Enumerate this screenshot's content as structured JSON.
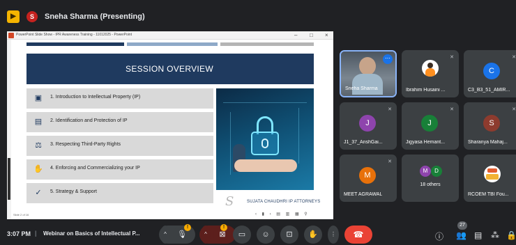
{
  "presenter_bar": {
    "app_icon": "meet-logo-icon",
    "presenter_initial": "S",
    "presenter_title": "Sneha Sharma (Presenting)"
  },
  "powerpoint": {
    "titlebar_text": "PowerPoint Slide Show - IPR Awareness Training - 11012025 - PowerPoint",
    "slide_status": "Slide 2 of 16",
    "slide": {
      "heading": "SESSION OVERVIEW",
      "items": [
        {
          "icon": "presentation-icon",
          "label": "1. Introduction to Intellectual Property (IP)"
        },
        {
          "icon": "certificate-icon",
          "label": "2. Identification and Protection of IP"
        },
        {
          "icon": "balance-icon",
          "label": "3. Respecting Third-Party Rights"
        },
        {
          "icon": "handshake-icon",
          "label": "4. Enforcing and Commercializing your IP"
        },
        {
          "icon": "checkmark-icon",
          "label": "5. Strategy & Support"
        }
      ],
      "firm_name": "SUJATA CHAUDHRI IP ATTORNEYS"
    }
  },
  "participants": [
    {
      "name": "Sneha Sharma",
      "type": "video",
      "speaking": true
    },
    {
      "name": "Ibrahim Husaini ...",
      "type": "photo",
      "muted": true
    },
    {
      "name": "C3_B3_51_AMIR...",
      "type": "initial",
      "initial": "C",
      "color": "#1a73e8",
      "muted": true
    },
    {
      "name": "J1_37_AnshGai...",
      "type": "initial",
      "initial": "J",
      "color": "#8e44ad",
      "muted": true
    },
    {
      "name": "Jigyasa Hemant...",
      "type": "initial",
      "initial": "J",
      "color": "#188038",
      "muted": true
    },
    {
      "name": "Sharanya Mahaj...",
      "type": "initial",
      "initial": "S",
      "color": "#8d3b2e",
      "muted": true
    },
    {
      "name": "MEET AGRAWAL",
      "type": "initial",
      "initial": "M",
      "color": "#e8710a",
      "muted": true
    },
    {
      "name": "18 others",
      "type": "group",
      "initials": [
        "M",
        "D"
      ]
    },
    {
      "name": "RCOEM TBI Fou...",
      "type": "logo"
    }
  ],
  "bottom_bar": {
    "time": "3:07 PM",
    "separator": "|",
    "meeting_title": "Webinar on Basics of Intellectual P...",
    "warning_badge": "!",
    "participant_count": "27",
    "controls": [
      "chevron-up-icon",
      "microphone-icon",
      "chevron-up-icon",
      "camera-off-icon",
      "captions-icon",
      "emoji-icon",
      "present-icon",
      "raise-hand-icon",
      "more-options-icon",
      "hangup-icon",
      "info-icon",
      "people-icon",
      "chat-icon",
      "activities-icon",
      "lock-icon"
    ]
  }
}
